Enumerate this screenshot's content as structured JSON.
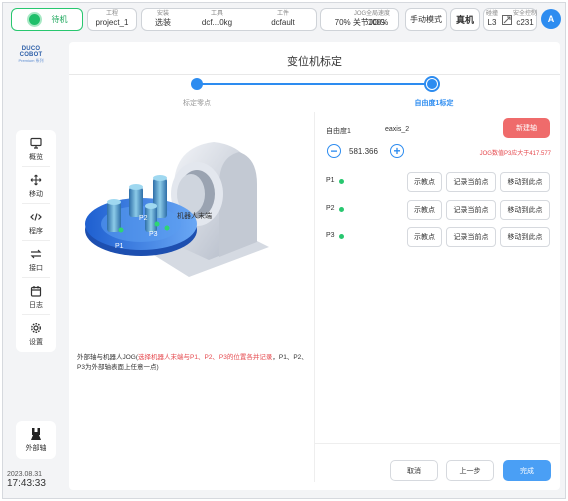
{
  "topbar": {
    "status": "待机",
    "project": {
      "label": "工程",
      "value": "project_1"
    },
    "mode": {
      "label": "安装",
      "value": "选装"
    },
    "tool": {
      "label": "工具",
      "value": "dcf...0kg"
    },
    "workpiece": {
      "label": "工件",
      "value": "dcfault"
    },
    "speed": {
      "value": "70%"
    },
    "jog": {
      "label": "JOG",
      "value": "关节JOG"
    },
    "global_speed": {
      "label": "全局速度",
      "value": "100%"
    },
    "manual_mode": "手动模式",
    "real_machine": "真机",
    "collision": {
      "label": "碰撞",
      "value": "L3"
    },
    "safety": {
      "label": "安全控制",
      "value": "c231"
    },
    "avatar": "A"
  },
  "logo": {
    "name": "DUCO COBOT",
    "series": "Premium 系列"
  },
  "sidebar": {
    "items": [
      {
        "label": "概览",
        "icon": "monitor-icon"
      },
      {
        "label": "移动",
        "icon": "move-arrows-icon"
      },
      {
        "label": "程序",
        "icon": "code-icon"
      },
      {
        "label": "接口",
        "icon": "swap-arrows-icon"
      },
      {
        "label": "日志",
        "icon": "calendar-icon"
      },
      {
        "label": "设置",
        "icon": "gear-icon"
      }
    ],
    "external_axis": "外部轴"
  },
  "datetime": {
    "date": "2023.08.31",
    "time": "17:43:33"
  },
  "main": {
    "title": "变位机标定",
    "steps": [
      {
        "label": "标定零点",
        "state": "done"
      },
      {
        "label": "自由度1标定",
        "state": "active"
      }
    ],
    "illustration": {
      "robot_end_label": "机器人末端",
      "points": [
        "P1",
        "P2",
        "P3"
      ]
    },
    "caption_prefix": "外部轴与机器人JOG(",
    "caption_red": "选择机器人末端与P1、P2、P3的位置各并记录",
    "caption_suffix": "，P1、P2、P3为外部轴表面上任意一点)",
    "axis": {
      "name": "自由度1",
      "code": "eaxis_2",
      "value": "581.366",
      "jog_warning": "JOG数值P3应大于417.577"
    },
    "new_button": "新建轴",
    "points": [
      {
        "label": "P1",
        "status_color": "#28c76f"
      },
      {
        "label": "P2",
        "status_color": "#28c76f"
      },
      {
        "label": "P3",
        "status_color": "#28c76f"
      }
    ],
    "point_buttons": {
      "teach": "示教点",
      "record": "记录当前点",
      "move": "移动到此点"
    },
    "footer": {
      "cancel": "取消",
      "prev": "上一步",
      "done": "完成"
    }
  },
  "colors": {
    "accent": "#2d8cf0",
    "success": "#28c76f",
    "danger": "#ef6b6b"
  }
}
